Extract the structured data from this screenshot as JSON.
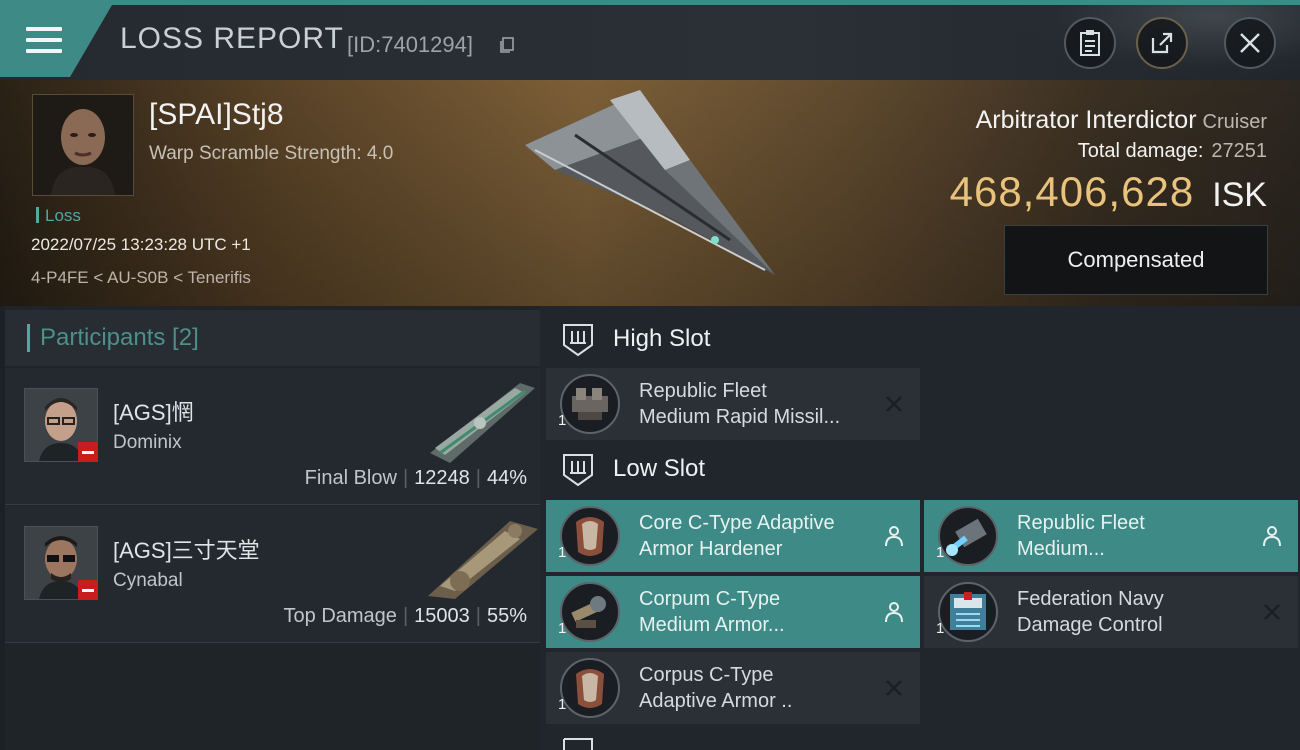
{
  "header": {
    "title": "LOSS REPORT",
    "report_id": "[ID:7401294]",
    "icons": [
      "menu-icon",
      "copy-icon",
      "clipboard-icon",
      "share-icon",
      "close-icon"
    ]
  },
  "victim": {
    "name": "[SPAI]Stj8",
    "warp_scramble": "Warp Scramble Strength: 4.0",
    "loss_tag": "Loss",
    "timestamp": "2022/07/25 13:23:28 UTC +1",
    "location": "4-P4FE < AU-S0B < Tenerifis",
    "ship_name": "Arbitrator Interdictor",
    "ship_class": "Cruiser",
    "total_damage_label": "Total damage:",
    "total_damage_value": "27251",
    "isk_value": "468,406,628",
    "isk_unit": "ISK",
    "compensated_label": "Compensated"
  },
  "participants": {
    "title": "Participants [2]",
    "rows": [
      {
        "name": "[AGS]惘",
        "ship": "Dominix",
        "role": "Final Blow",
        "damage": "12248",
        "percent": "44%"
      },
      {
        "name": "[AGS]三寸天堂",
        "ship": "Cynabal",
        "role": "Top Damage",
        "damage": "15003",
        "percent": "55%"
      }
    ]
  },
  "fitting": {
    "high_slot": {
      "label": "High Slot",
      "modules": [
        {
          "name": "Republic Fleet\nMedium Rapid Missil...",
          "qty": "1",
          "status": "destroyed",
          "active": false
        }
      ]
    },
    "low_slot": {
      "label": "Low Slot",
      "modules": [
        {
          "name": "Core C-Type Adaptive\n Armor Hardener",
          "qty": "1",
          "status": "dropped",
          "active": true
        },
        {
          "name": "Republic Fleet\nMedium...",
          "qty": "1",
          "status": "dropped",
          "active": true
        },
        {
          "name": "Corpum C-Type\nMedium Armor...",
          "qty": "1",
          "status": "dropped",
          "active": true
        },
        {
          "name": "Federation Navy\nDamage Control",
          "qty": "1",
          "status": "destroyed",
          "active": false
        },
        {
          "name": "Corpus C-Type\nAdaptive Armor ..",
          "qty": "1",
          "status": "destroyed",
          "active": false
        }
      ]
    }
  },
  "colors": {
    "accent": "#3d8a86",
    "isk": "#e9c27c",
    "badge": "#c91d1d"
  }
}
